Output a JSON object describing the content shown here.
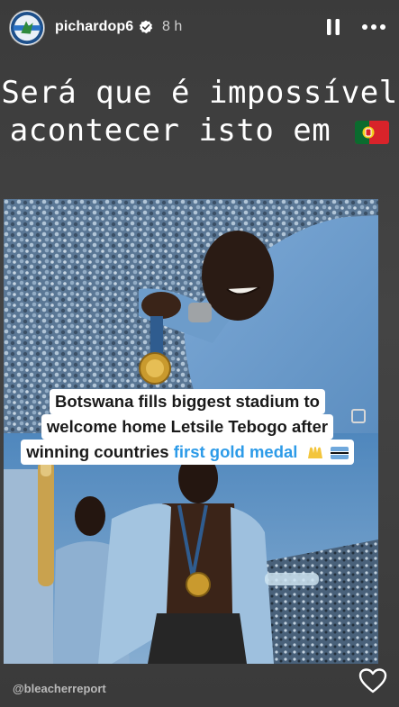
{
  "header": {
    "username": "pichardop6",
    "time": "8 h",
    "avatar_icon": "profile-avatar-icon",
    "verified_icon": "verified-badge-icon",
    "pause_icon": "pause-icon",
    "more_icon": "more-dots-icon"
  },
  "caption": {
    "line1": "Será que é impossível",
    "line2": "acontecer isto em",
    "flag_icon": "portugal-flag-icon"
  },
  "post": {
    "headline_line1": "Botswana fills biggest stadium to",
    "headline_line2": "welcome home Letsile Tebogo after",
    "headline_line3_pre": "winning countries ",
    "headline_line3_accent": "first gold medal",
    "emoji_icons": [
      "raised-hands-icon",
      "botswana-flag-icon"
    ],
    "accent_color": "#2d9be8"
  },
  "footer": {
    "credit": "@bleacherreport",
    "heart_icon": "heart-icon"
  }
}
